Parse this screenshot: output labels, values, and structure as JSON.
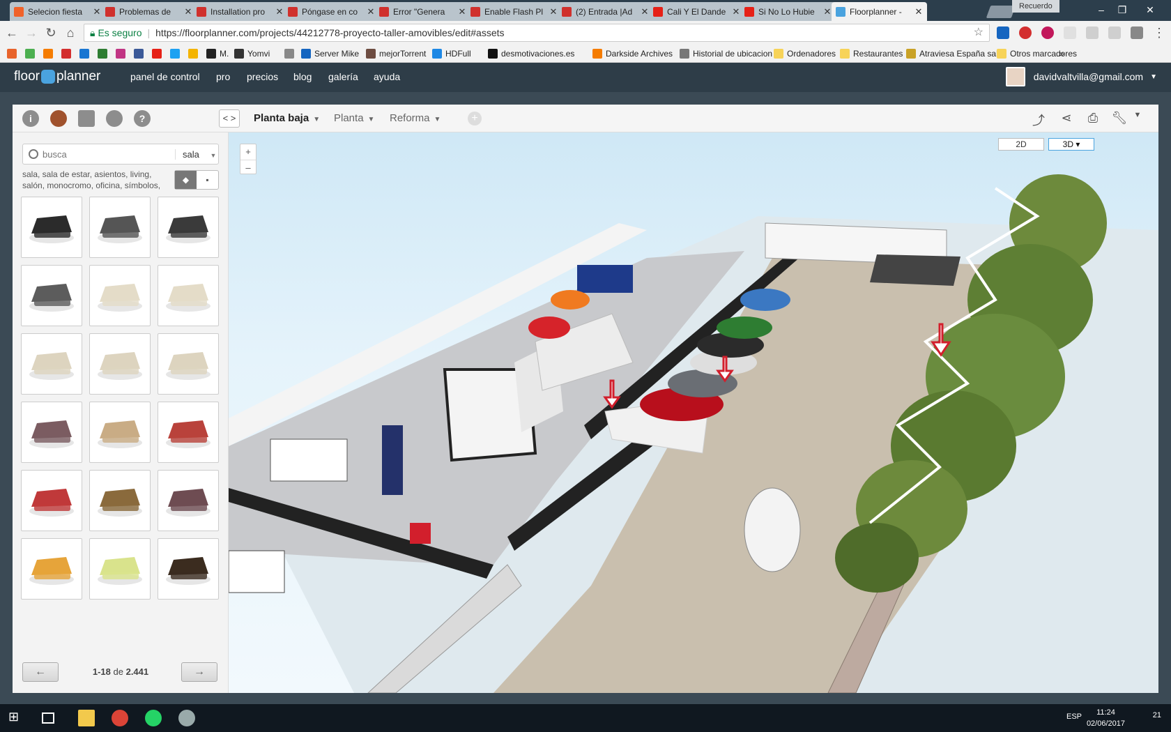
{
  "browser": {
    "tabs": [
      {
        "title": "Selecion fiesta",
        "color": "#f0622a"
      },
      {
        "title": "Problemas de",
        "color": "#d0312d"
      },
      {
        "title": "Installation pro",
        "color": "#d0312d"
      },
      {
        "title": "Póngase en co",
        "color": "#d0312d"
      },
      {
        "title": "Error \"Genera",
        "color": "#d0312d"
      },
      {
        "title": "Enable Flash Pl",
        "color": "#d0312d"
      },
      {
        "title": "(2) Entrada |Ad",
        "color": "#d0312d"
      },
      {
        "title": "Cali Y El Dande",
        "color": "#e62117"
      },
      {
        "title": "Si No Lo Hubie",
        "color": "#e62117"
      },
      {
        "title": "Floorplanner -",
        "color": "#4aa3df"
      }
    ],
    "profile_chip": "Recuerdo",
    "secure_label": "Es seguro",
    "url": "https://floorplanner.com/projects/44212778-proyecto-taller-amovibles/edit#assets",
    "bookmarks": [
      {
        "label": "",
        "color": "#e8632b"
      },
      {
        "label": "",
        "color": "#4caf50"
      },
      {
        "label": "",
        "color": "#f57c00"
      },
      {
        "label": "",
        "color": "#d32f2f"
      },
      {
        "label": "",
        "color": "#1976d2"
      },
      {
        "label": "",
        "color": "#2e7d32"
      },
      {
        "label": "",
        "color": "#c13584"
      },
      {
        "label": "",
        "color": "#3b5998"
      },
      {
        "label": "",
        "color": "#e62117"
      },
      {
        "label": "",
        "color": "#1da1f2"
      },
      {
        "label": "",
        "color": "#f4b400"
      },
      {
        "label": "M.",
        "color": "#222"
      },
      {
        "label": "Yomvi",
        "color": "#333"
      },
      {
        "label": "",
        "color": "#888"
      },
      {
        "label": "Server Mike",
        "color": "#1565c0"
      },
      {
        "label": "mejorTorrent",
        "color": "#6d4c41"
      },
      {
        "label": "HDFull",
        "color": "#1e88e5"
      },
      {
        "label": "desmotivaciones.es",
        "color": "#111"
      },
      {
        "label": "Darkside Archives",
        "color": "#f57c00"
      },
      {
        "label": "Historial de ubicacion",
        "color": "#777"
      },
      {
        "label": "Ordenadores",
        "color": "#f7d358"
      },
      {
        "label": "Restaurantes",
        "color": "#f7d358"
      },
      {
        "label": "Atraviesa España salta",
        "color": "#c9a227"
      },
      {
        "label": "Otros marcadores",
        "color": "#f7d358"
      }
    ]
  },
  "app": {
    "logo_left": "floor",
    "logo_right": "planner",
    "nav": [
      "panel de control",
      "pro",
      "precios",
      "blog",
      "galería",
      "ayuda"
    ],
    "user_email": "davidvaltvilla@gmail.com"
  },
  "toolbar": {
    "left_icons": [
      "info-icon",
      "furniture-icon",
      "photos-icon",
      "globe-icon",
      "help-icon"
    ],
    "left_glyphs": [
      "i",
      "",
      "",
      "",
      "?"
    ],
    "floors": [
      {
        "label": "Planta baja",
        "active": true
      },
      {
        "label": "Planta",
        "active": false
      },
      {
        "label": "Reforma",
        "active": false
      }
    ],
    "add_glyph": "+",
    "arrows": "< >"
  },
  "library": {
    "search_placeholder": "busca",
    "category": "sala",
    "tags": "sala, sala de estar, asientos, living, salón, monocromo, oficina, símbolos,",
    "items": [
      {
        "name": "black-lounge-chair",
        "color": "#2b2b2b"
      },
      {
        "name": "eames-lounge-chair",
        "color": "#555"
      },
      {
        "name": "black-chaise",
        "color": "#3a3a3a"
      },
      {
        "name": "eames-ottoman",
        "color": "#5c5c5c"
      },
      {
        "name": "cream-armchair",
        "color": "#e4dcc8"
      },
      {
        "name": "cream-loveseat",
        "color": "#e4dcc8"
      },
      {
        "name": "cream-sofa",
        "color": "#ddd4bf"
      },
      {
        "name": "cream-corner-sofa",
        "color": "#ddd4bf"
      },
      {
        "name": "cream-l-sofa",
        "color": "#ddd4bf"
      },
      {
        "name": "mauve-sofa",
        "color": "#7b5c61"
      },
      {
        "name": "tan-chaise",
        "color": "#c9ac85"
      },
      {
        "name": "red-chesterfield",
        "color": "#b9423b"
      },
      {
        "name": "red-sofa",
        "color": "#c0393a"
      },
      {
        "name": "wood-armchair",
        "color": "#8a6a3c"
      },
      {
        "name": "mauve-armchair",
        "color": "#6e4c52"
      },
      {
        "name": "orange-tub-chair",
        "color": "#e6a43a"
      },
      {
        "name": "lime-chaise",
        "color": "#d9e38c"
      },
      {
        "name": "brown-rocker",
        "color": "#3b2c1f"
      }
    ],
    "pager": {
      "range": "1-18",
      "of": "de",
      "total": "2.441",
      "prev": "←",
      "next": "→"
    }
  },
  "canvas": {
    "zoom_in": "+",
    "zoom_out": "–",
    "view_2d": "2D",
    "view_3d": "3D ▾"
  },
  "taskbar": {
    "time": "11:24",
    "date": "02/06/2017",
    "lang": "ESP",
    "notifications": "21"
  }
}
